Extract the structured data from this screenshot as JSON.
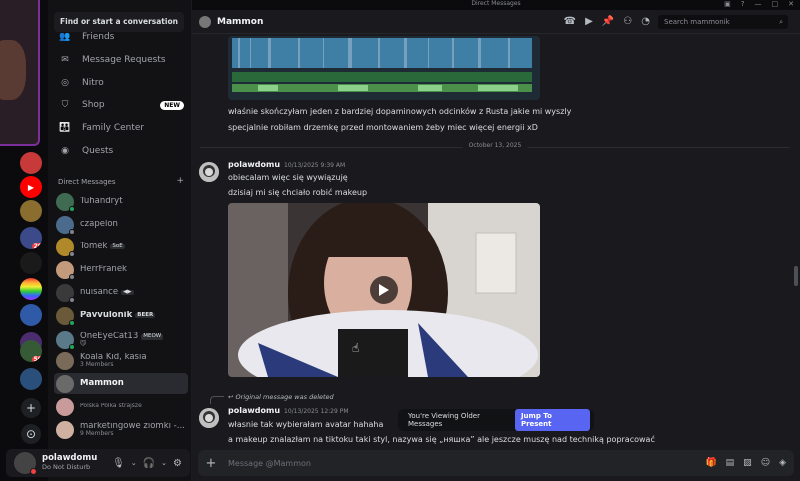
{
  "window": {
    "title": "Direct Messages"
  },
  "servers": [
    {
      "badge": ""
    },
    {
      "badge": ""
    },
    {
      "badge": ""
    },
    {
      "badge": "20"
    },
    {
      "badge": ""
    },
    {
      "badge": ""
    },
    {
      "badge": ""
    },
    {
      "badge": ""
    },
    {
      "badge": "50"
    },
    {
      "badge": ""
    }
  ],
  "sidebar": {
    "search_label": "Find or start a conversation",
    "nav": [
      {
        "label": "Friends"
      },
      {
        "label": "Message Requests"
      },
      {
        "label": "Nitro"
      },
      {
        "label": "Shop",
        "badge": "NEW"
      },
      {
        "label": "Family Center"
      },
      {
        "label": "Quests"
      }
    ],
    "dm_header": "Direct Messages",
    "dm_add": "+",
    "dms": [
      {
        "name": "Tuhandryt",
        "sub": "",
        "tag": "",
        "status_color": "#23a55a"
      },
      {
        "name": "czapelon",
        "sub": "",
        "tag": "",
        "status_color": "#80848e"
      },
      {
        "name": "Tomek",
        "sub": "",
        "tag": "SoE",
        "status_color": "#80848e"
      },
      {
        "name": "HerrFranek",
        "sub": "",
        "tag": "",
        "status_color": "#80848e"
      },
      {
        "name": "nuisance",
        "sub": "",
        "tag": "◀▶",
        "status_color": "#80848e"
      },
      {
        "name": "Pavvulonik",
        "sub": "",
        "tag": "BEER",
        "status_color": "#23a55a"
      },
      {
        "name": "OneEyeCat13",
        "sub": "😼",
        "tag": "MEOW",
        "status_color": "#23a55a"
      },
      {
        "name": "Koala Kid, kasia",
        "sub": "3 Members",
        "tag": "",
        "status_color": ""
      },
      {
        "name": "Mammon",
        "sub": "",
        "tag": "",
        "status_color": ""
      },
      {
        "name": "Polska Polka strajsze",
        "sub": "",
        "tag": "",
        "status_color": ""
      },
      {
        "name": "marketingowe ziomki -...",
        "sub": "9 Members",
        "tag": "",
        "status_color": ""
      }
    ],
    "user": {
      "name": "polawdomu",
      "status": "Do Not Disturb"
    }
  },
  "chat": {
    "recipient": "Mammon",
    "search_placeholder": "Search mammonik",
    "messages_top": [
      "właśnie skończyłam jeden z bardziej dopaminowych odcinków z Rusta jakie mi wyszly",
      "specjalnie robiłam drzemkę przed montowaniem żeby miec więcej energii xD"
    ],
    "date_divider": "October 13, 2025",
    "group1": {
      "author": "polawdomu",
      "time": "10/13/2025 9:39 AM",
      "lines": [
        "obiecalam więc się wywiązuję",
        "dzisiaj mi się chciało robić makeup"
      ]
    },
    "deleted_notice": "Original message was deleted",
    "group2": {
      "author": "polawdomu",
      "time": "10/13/2025 12:29 PM",
      "lines": [
        "własnie tak wybierałam avatar hahaha",
        "a makeup znalazłam na tiktoku taki styl, nazywa się „няшка” ale jeszcze muszę nad techniką popracować"
      ]
    },
    "older_banner": {
      "label": "You're Viewing Older Messages",
      "button": "Jump To Present"
    },
    "composer_placeholder": "Message @Mammon"
  }
}
